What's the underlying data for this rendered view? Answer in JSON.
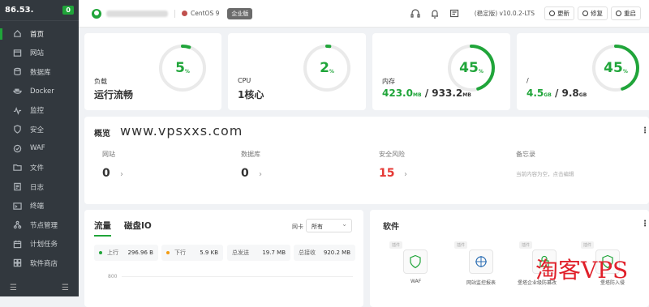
{
  "sidebar": {
    "server_ip": "86.53.",
    "badge": "0",
    "items": [
      {
        "label": "首页",
        "icon": "home-icon"
      },
      {
        "label": "网站",
        "icon": "globe-icon"
      },
      {
        "label": "数据库",
        "icon": "database-icon"
      },
      {
        "label": "Docker",
        "icon": "docker-icon"
      },
      {
        "label": "监控",
        "icon": "monitor-icon"
      },
      {
        "label": "安全",
        "icon": "shield-icon"
      },
      {
        "label": "WAF",
        "icon": "waf-icon"
      },
      {
        "label": "文件",
        "icon": "folder-icon"
      },
      {
        "label": "日志",
        "icon": "log-icon"
      },
      {
        "label": "终端",
        "icon": "terminal-icon"
      },
      {
        "label": "节点管理",
        "icon": "node-icon"
      },
      {
        "label": "计划任务",
        "icon": "calendar-icon"
      },
      {
        "label": "软件商店",
        "icon": "store-icon"
      }
    ]
  },
  "topbar": {
    "os": "CentOS 9",
    "edition": "企业版",
    "version": "(稳定版) v10.0.2-LTS",
    "buttons": [
      "更新",
      "修复",
      "重启"
    ]
  },
  "stats": [
    {
      "label": "负载",
      "value": "运行流畅",
      "gauge": "5",
      "percent": 5
    },
    {
      "label": "CPU",
      "value": "1核心",
      "gauge": "2",
      "percent": 2
    },
    {
      "label": "内存",
      "used": "423.0",
      "used_unit": "MB",
      "sep": " / ",
      "total": "933.2",
      "total_unit": "MB",
      "gauge": "45",
      "percent": 45
    },
    {
      "label": "/",
      "used": "4.5",
      "used_unit": "GB",
      "sep": " / ",
      "total": "9.8",
      "total_unit": "GB",
      "gauge": "45",
      "percent": 45
    }
  ],
  "gauge_unit": "%",
  "overview": {
    "title": "概览",
    "watermark": "www.vpsxxs.com",
    "items": [
      {
        "label": "网站",
        "value": "0"
      },
      {
        "label": "数据库",
        "value": "0"
      },
      {
        "label": "安全风险",
        "value": "15"
      },
      {
        "label": "备忘录",
        "value": "当前内容为空，点击编辑"
      }
    ]
  },
  "traffic": {
    "tabs": [
      "流量",
      "磁盘IO"
    ],
    "nic_label": "网卡",
    "nic_value": "所有",
    "metrics": [
      {
        "label": "上行",
        "value": "296.96 B",
        "color": "#20a53a"
      },
      {
        "label": "下行",
        "value": "5.9 KB",
        "color": "#f39c12"
      },
      {
        "label": "总发送",
        "value": "19.7 MB"
      },
      {
        "label": "总接收",
        "value": "920.2 MB"
      }
    ],
    "axis_label": "800"
  },
  "software": {
    "title": "软件",
    "items": [
      {
        "tag": "插件",
        "name": "WAF"
      },
      {
        "tag": "插件",
        "name": "网站监控报表"
      },
      {
        "tag": "插件",
        "name": "堡塔企业级防篡改"
      },
      {
        "tag": "插件",
        "name": "堡塔防入侵"
      }
    ]
  },
  "watermark2": "淘客VPS",
  "colors": {
    "accent": "#20a53a",
    "danger": "#e53935",
    "sidebar": "#32383e"
  }
}
